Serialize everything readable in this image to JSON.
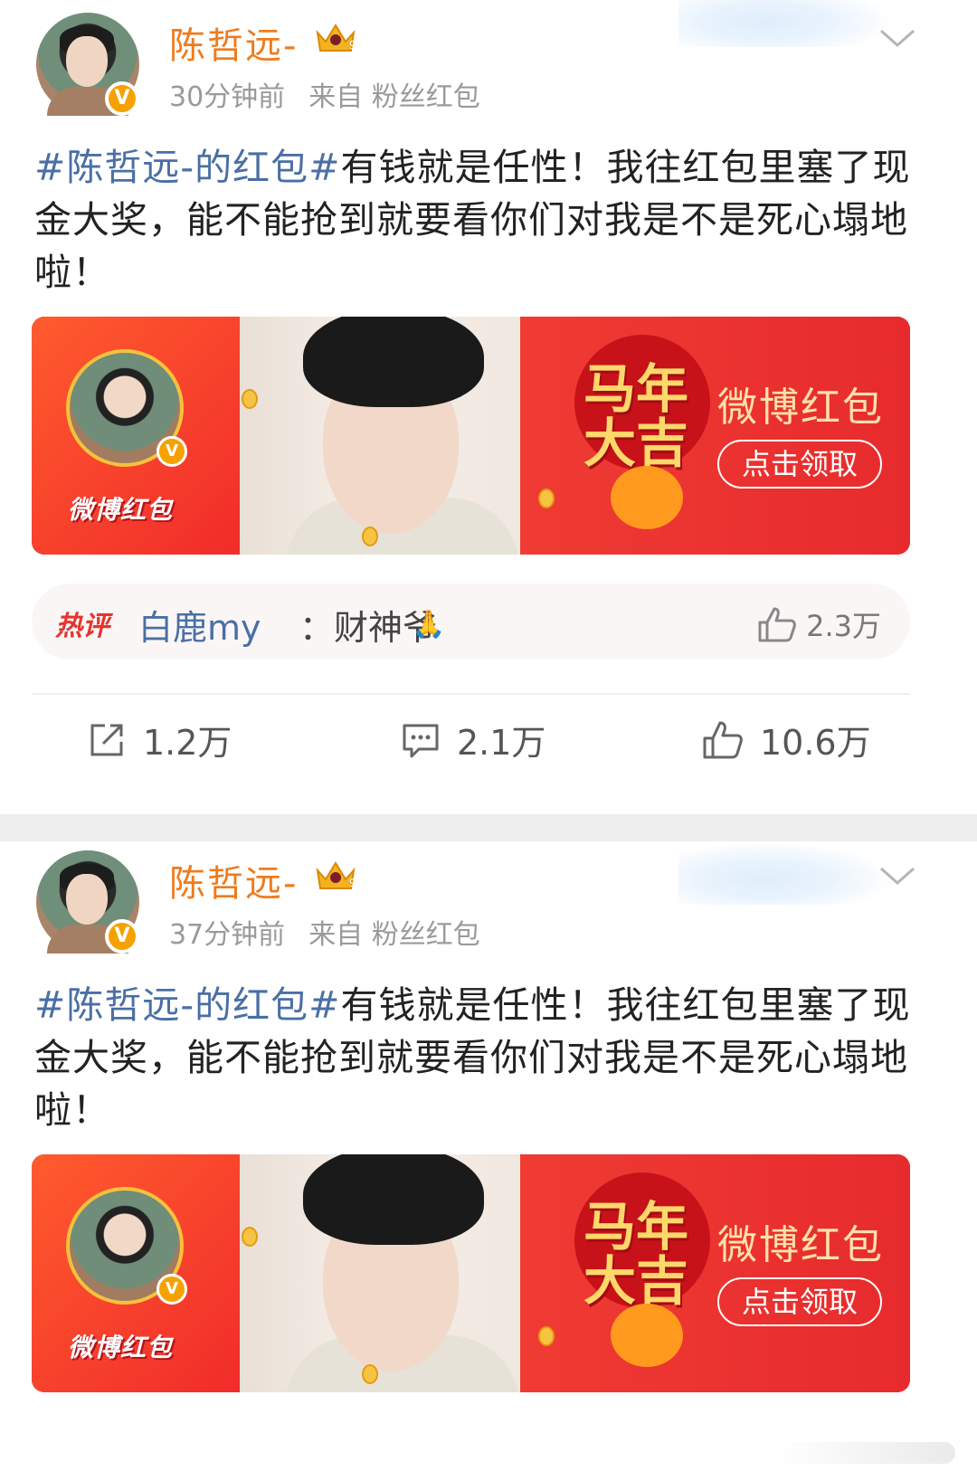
{
  "posts": [
    {
      "username": "陈哲远-",
      "time": "30分钟前",
      "source": "来自 粉丝红包",
      "hashtag": "#陈哲远-的红包#",
      "body": "有钱就是任性！我往红包里塞了现金大奖，能不能抢到就要看你们对我是不是死心塌地啦！",
      "banner": {
        "logo": "微博红包",
        "slogan": "马年大吉",
        "title": "微博红包",
        "button": "点击领取"
      },
      "hot_comment": {
        "label": "热评",
        "user": "白鹿my",
        "text": "：财神爷",
        "emoji": "🙏",
        "likes": "2.3万"
      },
      "actions": {
        "share": "1.2万",
        "comment": "2.1万",
        "like": "10.6万"
      }
    },
    {
      "username": "陈哲远-",
      "time": "37分钟前",
      "source": "来自 粉丝红包",
      "hashtag": "#陈哲远-的红包#",
      "body": "有钱就是任性！我往红包里塞了现金大奖，能不能抢到就要看你们对我是不是死心塌地啦！",
      "banner": {
        "logo": "微博红包",
        "slogan": "马年大吉",
        "title": "微博红包",
        "button": "点击领取"
      }
    }
  ],
  "icons": {
    "crown": "crown-icon",
    "chevron": "chevron-down-icon",
    "share": "share-icon",
    "comment": "comment-icon",
    "like": "thumbs-up-icon"
  },
  "colors": {
    "username": "#f07b1c",
    "hashtag": "#4a6fa5",
    "banner_red": "#e8262b",
    "verified": "#f5a200"
  }
}
